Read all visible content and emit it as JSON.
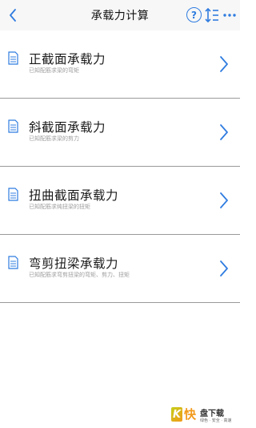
{
  "navbar": {
    "title": "承载力计算",
    "help_symbol": "?"
  },
  "items": [
    {
      "title": "正截面承载力",
      "subtitle": "已知配筋求梁的弯矩"
    },
    {
      "title": "斜截面承载力",
      "subtitle": "已知配筋求梁的剪力"
    },
    {
      "title": "扭曲截面承载力",
      "subtitle": "已知配筋求纯扭梁的扭矩"
    },
    {
      "title": "弯剪扭梁承载力",
      "subtitle": "已知配筋求弯剪扭梁的弯矩、剪力、扭矩"
    }
  ],
  "watermark": {
    "k": "K",
    "kuai": "快",
    "name": "盘下载",
    "tagline": "绿色 · 安全 · 高速"
  },
  "colors": {
    "accent": "#2f7ce0",
    "divider": "#9a9a9a",
    "navbar_bg": "#f7f7f7"
  },
  "icons": [
    "back-chevron-icon",
    "help-icon",
    "sort-lines-icon",
    "more-dots-icon",
    "document-icon",
    "chevron-right-icon"
  ]
}
